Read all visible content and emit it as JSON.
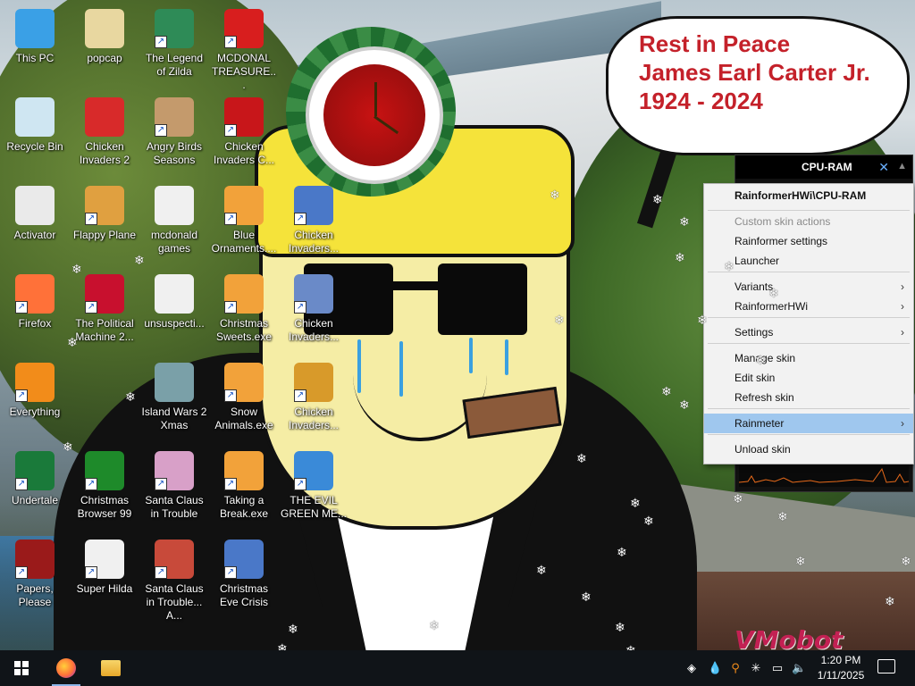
{
  "desktop": {
    "icons": [
      {
        "label": "This PC",
        "icon": "computer-icon",
        "color": "#3aa0e6",
        "shortcut": false
      },
      {
        "label": "popcap",
        "icon": "folder-icon",
        "color": "#e8d7a0",
        "shortcut": false
      },
      {
        "label": "The Legend of Zilda",
        "icon": "game-icon",
        "color": "#2e8b57",
        "shortcut": true
      },
      {
        "label": "MCDONAL TREASURE...",
        "icon": "mcdonalds-icon",
        "color": "#d81e1e",
        "shortcut": true
      },
      {
        "label": "Recycle Bin",
        "icon": "recycle-bin-icon",
        "color": "#cfe6f2",
        "shortcut": false
      },
      {
        "label": "Chicken Invaders 2",
        "icon": "chicken-icon",
        "color": "#d82a2a",
        "shortcut": false
      },
      {
        "label": "Angry Birds Seasons",
        "icon": "angry-bird-icon",
        "color": "#c49a6c",
        "shortcut": true
      },
      {
        "label": "Chicken Invaders C...",
        "icon": "chicken-icon",
        "color": "#c8161a",
        "shortcut": true
      },
      {
        "label": "Activator",
        "icon": "folder-icon",
        "color": "#eaeaea",
        "shortcut": false
      },
      {
        "label": "Flappy Plane",
        "icon": "plane-icon",
        "color": "#e0a040",
        "shortcut": true
      },
      {
        "label": "mcdonald games",
        "icon": "folder-icon",
        "color": "#f0f0f0",
        "shortcut": false
      },
      {
        "label": "Blue Ornaments....",
        "icon": "app-icon",
        "color": "#f2a23a",
        "shortcut": true
      },
      {
        "label": "Chicken Invaders...",
        "icon": "chicken-icon",
        "color": "#4a78c8",
        "shortcut": true
      },
      {
        "label": "Firefox",
        "icon": "firefox-icon",
        "color": "#ff7139",
        "shortcut": true
      },
      {
        "label": "The Political Machine 2...",
        "icon": "political-icon",
        "color": "#c8102e",
        "shortcut": true
      },
      {
        "label": "unsuspecti...",
        "icon": "folder-icon",
        "color": "#f0f0f0",
        "shortcut": false
      },
      {
        "label": "Christmas Sweets.exe",
        "icon": "app-icon",
        "color": "#f2a23a",
        "shortcut": true
      },
      {
        "label": "Chicken Invaders...",
        "icon": "chicken-icon",
        "color": "#6a8ac8",
        "shortcut": true
      },
      {
        "label": "Everything",
        "icon": "search-icon",
        "color": "#f28c1a",
        "shortcut": true
      },
      {
        "label": "Island Wars 2 Xmas",
        "icon": "island-icon",
        "color": "#7aa0a8",
        "shortcut": false
      },
      {
        "label": "Snow Animals.exe",
        "icon": "app-icon",
        "color": "#f2a23a",
        "shortcut": true
      },
      {
        "label": "Chicken Invaders...",
        "icon": "chicken-icon",
        "color": "#d89a2a",
        "shortcut": true
      },
      {
        "label": "Undertale",
        "icon": "undertale-icon",
        "color": "#1a7a3a",
        "shortcut": true
      },
      {
        "label": "Christmas Browser 99",
        "icon": "tree-icon",
        "color": "#1e8a2a",
        "shortcut": true
      },
      {
        "label": "Santa Claus in Trouble",
        "icon": "santa-icon",
        "color": "#d8a0c8",
        "shortcut": true
      },
      {
        "label": "Taking a Break.exe",
        "icon": "app-icon",
        "color": "#f2a23a",
        "shortcut": true
      },
      {
        "label": "THE EVIL GREEN ME...",
        "icon": "messenger-icon",
        "color": "#3a8ad8",
        "shortcut": true
      },
      {
        "label": "Papers, Please",
        "icon": "papers-please-icon",
        "color": "#9a1a1a",
        "shortcut": true
      },
      {
        "label": "Super Hilda",
        "icon": "pixel-icon",
        "color": "#f0f0f0",
        "shortcut": true
      },
      {
        "label": "Santa Claus in Trouble... A...",
        "icon": "santa-icon",
        "color": "#c84a3a",
        "shortcut": true
      },
      {
        "label": "Christmas Eve Crisis",
        "icon": "santa-icon",
        "color": "#4a78c8",
        "shortcut": true
      }
    ]
  },
  "bubble": {
    "line1": "Rest in Peace",
    "line2": "James Earl Carter Jr.",
    "line3": "1924 - 2024",
    "color": "#c4212a"
  },
  "skin": {
    "title": "CPU-RAM"
  },
  "context_menu": {
    "header": "RainformerHWi\\CPU-RAM",
    "items": [
      {
        "label": "Custom skin actions",
        "disabled": true,
        "submenu": false
      },
      {
        "label": "Rainformer settings",
        "disabled": false,
        "submenu": false
      },
      {
        "label": "Launcher",
        "disabled": false,
        "submenu": false
      },
      {
        "label": "Variants",
        "disabled": false,
        "submenu": true
      },
      {
        "label": "RainformerHWi",
        "disabled": false,
        "submenu": true
      },
      {
        "label": "Settings",
        "disabled": false,
        "submenu": true
      },
      {
        "label": "Manage skin",
        "disabled": false,
        "submenu": false
      },
      {
        "label": "Edit skin",
        "disabled": false,
        "submenu": false
      },
      {
        "label": "Refresh skin",
        "disabled": false,
        "submenu": false
      },
      {
        "label": "Rainmeter",
        "disabled": false,
        "submenu": true,
        "highlighted": true
      },
      {
        "label": "Unload skin",
        "disabled": false,
        "submenu": false
      }
    ],
    "highlight_color": "#9fc7ee"
  },
  "watermark": "VMobot",
  "taskbar": {
    "apps": [
      {
        "name": "firefox-taskbar-button",
        "icon": "firefox-icon",
        "color": "#ff7139"
      },
      {
        "name": "file-explorer-taskbar-button",
        "icon": "folder-icon",
        "color": "#f2c14a"
      }
    ],
    "tray_icons": [
      "rainmeter-icon",
      "water-drop-icon",
      "search-icon",
      "snowflake-icon",
      "network-icon",
      "volume-muted-icon"
    ],
    "time": "1:20 PM",
    "date": "1/11/2025"
  }
}
